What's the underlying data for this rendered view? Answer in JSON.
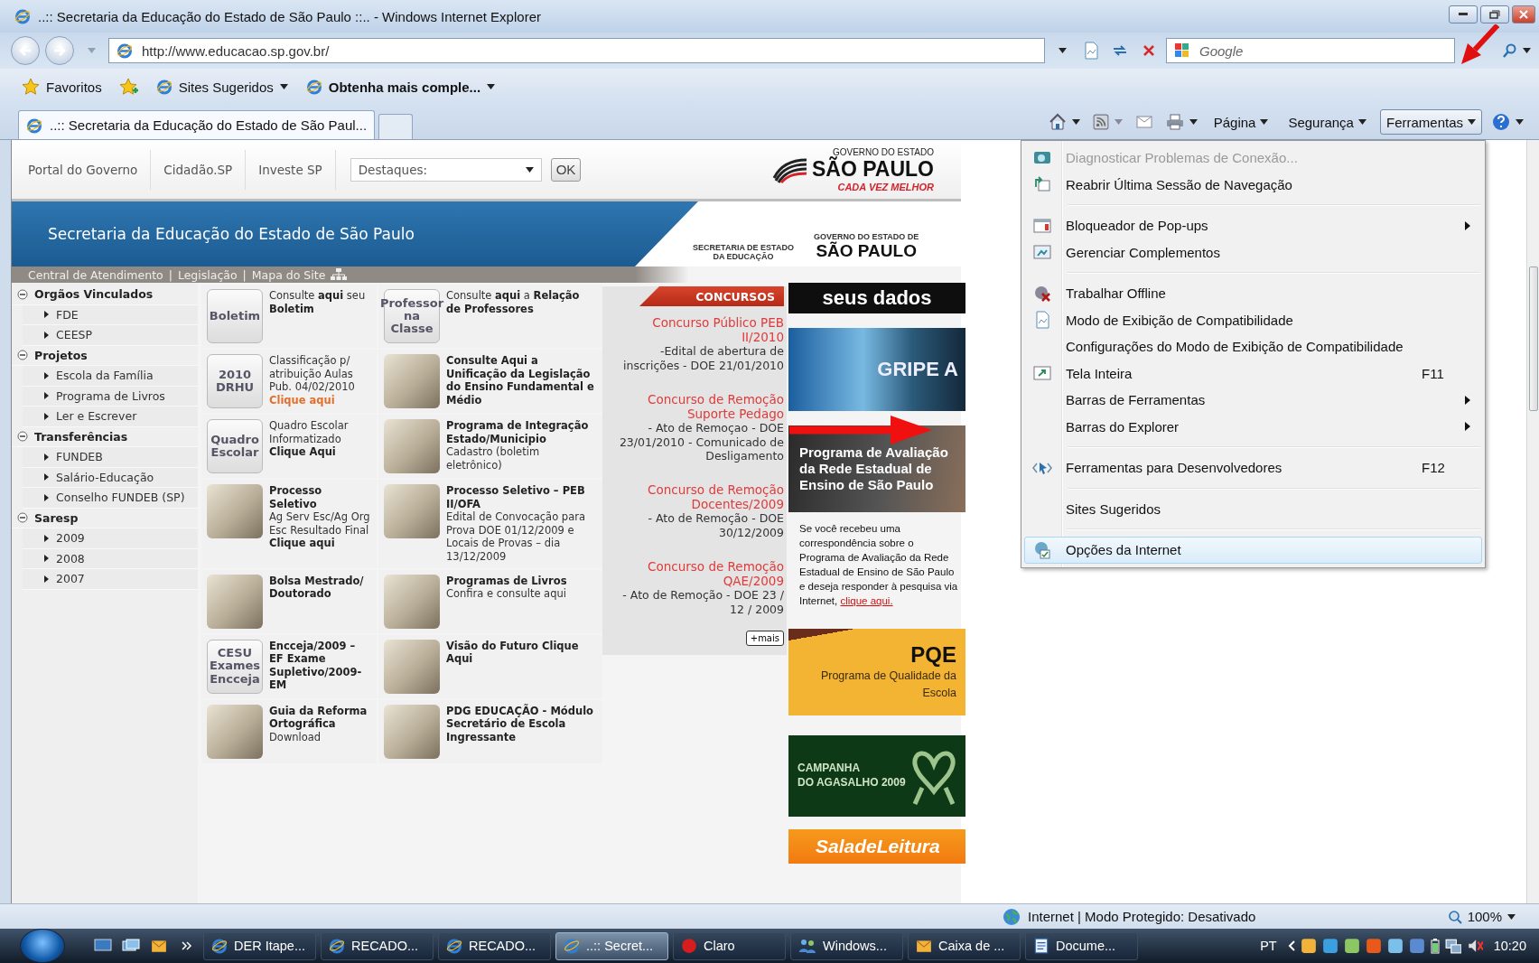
{
  "window": {
    "title": "..:: Secretaria da Educação do Estado de São Paulo ::.. - Windows Internet Explorer"
  },
  "address_bar": {
    "url": "http://www.educacao.sp.gov.br/"
  },
  "search": {
    "placeholder": "Google"
  },
  "favorites_bar": {
    "favorites": "Favoritos",
    "items": [
      {
        "label": "Sites Sugeridos",
        "bold": false
      },
      {
        "label": "Obtenha mais comple...",
        "bold": true
      }
    ]
  },
  "tabs": [
    {
      "label": "..:: Secretaria da Educação do Estado de São Paul...",
      "selected": true
    }
  ],
  "command_bar": {
    "items": [
      {
        "label": "Página",
        "selected": false
      },
      {
        "label": "Segurança",
        "selected": false
      },
      {
        "label": "Ferramentas",
        "selected": true
      }
    ]
  },
  "site": {
    "top_links": [
      "Portal do Governo",
      "Cidadão.SP",
      "Investe SP"
    ],
    "highlights_select": "Destaques:",
    "ok_button": "OK",
    "logo": {
      "top": "GOVERNO DO ESTADO",
      "name": "SÃO PAULO",
      "motto": "CADA VEZ MELHOR"
    },
    "banner": {
      "title": "Secretaria da Educação do Estado de São Paulo",
      "logos": [
        {
          "small": "SECRETARIA DE ESTADO DA EDUCAÇÃO"
        },
        {
          "small": "GOVERNO DO ESTADO DE",
          "big": "SÃO PAULO"
        }
      ]
    },
    "links": {
      "items": [
        "Central de Atendimento",
        "Legislação",
        "Mapa do Site"
      ],
      "separator": "|"
    },
    "sidebar": [
      {
        "label": "Orgãos Vinculados",
        "expanded": true,
        "children": [
          {
            "label": "FDE"
          },
          {
            "label": "CEESP"
          }
        ]
      },
      {
        "label": "Projetos",
        "expanded": true,
        "children": [
          {
            "label": "Escola da Família"
          },
          {
            "label": "Programa de Livros"
          },
          {
            "label": "Ler e Escrever"
          }
        ]
      },
      {
        "label": "Transferências",
        "expanded": true,
        "children": [
          {
            "label": "FUNDEB"
          },
          {
            "label": "Salário-Educação"
          },
          {
            "label": "Conselho FUNDEB (SP)"
          }
        ]
      },
      {
        "label": "Saresp",
        "expanded": true,
        "children": [
          {
            "label": "2009"
          },
          {
            "label": "2008"
          },
          {
            "label": "2007"
          }
        ]
      }
    ],
    "tiles": [
      {
        "image_text": [
          "Boletim"
        ],
        "text": "Consulte **aqui** seu **Boletim**"
      },
      {
        "image_text": [
          "Professor",
          "na Classe"
        ],
        "text": "Consulte **aqui** a **Relação de Professores**"
      },
      {
        "image_text": [
          "2010",
          "DRHU"
        ],
        "text": "Classificação p/ atribuição Aulas Pub. 04/02/2010",
        "link": "Clique aqui"
      },
      {
        "title": "Consulte Aqui a Unificação da Legislação do Ensino Fundamental e Médio"
      },
      {
        "image_text": [
          "Quadro",
          "Escolar"
        ],
        "text": "Quadro Escolar Informatizado **Clique Aqui**"
      },
      {
        "title": "Programa de Integração Estado/Municipio",
        "text": "Cadastro (boletim eletrônico)"
      },
      {
        "title": "Processo Seletivo",
        "text": "Ag Serv Esc/Ag Org Esc Resultado Final **Clique aqui**"
      },
      {
        "title": "Processo Seletivo – PEB II/OFA",
        "text": "Edital de Convocação para Prova DOE 01/12/2009 e Locais de Provas – dia 13/12/2009"
      },
      {
        "title": "Bolsa Mestrado/ Doutorado"
      },
      {
        "title": "Programas de Livros",
        "text": "Confira e consulte aqui"
      },
      {
        "image_text": [
          "CESU",
          "Exames",
          "Encceja"
        ],
        "title": "Encceja/2009 – EF Exame Supletivo/2009- EM"
      },
      {
        "title": "Visão do Futuro Clique Aqui"
      },
      {
        "title": "Guia da Reforma Ortográfica",
        "text": "Download"
      },
      {
        "title": "PDG EDUCAÇÃO - Módulo Secretário de Escola Ingressante"
      }
    ],
    "contests": {
      "header": "CONCURSOS",
      "more": "+mais",
      "items": [
        {
          "title": "Concurso Público PEB II/2010",
          "body": "-Edital de abertura de inscrições - DOE 21/01/2010"
        },
        {
          "title": "Concurso de Remoção Suporte Pedago",
          "body": "- Ato de Remoçao - DOE 23/01/2010 - Comunicado de Desligamento"
        },
        {
          "title": "Concurso de Remoção Docentes/2009",
          "body": "- Ato de Remoção - DOE 30/12/2009"
        },
        {
          "title": "Concurso de Remoção QAE/2009",
          "body": "- Ato de Remoção - DOE 23 / 12 / 2009"
        }
      ]
    },
    "promos": {
      "account": "seus dados",
      "flu": "GRIPE A",
      "survey": {
        "banner": "Programa de Avaliação da Rede Estadual de Ensino de São Paulo",
        "text": "Se você recebeu uma correspondência sobre o Programa de Avaliação da Rede Estadual de Ensino de São Paulo e deseja responder à pesquisa via Internet,",
        "link": "clique aqui."
      },
      "pqe": {
        "title": "PQE",
        "subtitle": "Programa de Qualidade da Escola"
      },
      "campaign": [
        "CAMPANHA",
        "DO AGASALHO 2009"
      ],
      "reading": "SaladeLeitura"
    }
  },
  "tools_menu": {
    "groups": [
      [
        {
          "label": "Diagnosticar Problemas de Conexão...",
          "kind": "connection",
          "submenu": false,
          "disabled": true,
          "selected": false
        },
        {
          "label": "Reabrir Última Sessão de Navegação",
          "kind": "reopen",
          "submenu": false,
          "disabled": false,
          "selected": false
        }
      ],
      [
        {
          "label": "Bloqueador de Pop-ups",
          "kind": "popup",
          "submenu": true,
          "disabled": false,
          "selected": false
        },
        {
          "label": "Gerenciar Complementos",
          "kind": "addons",
          "submenu": false,
          "disabled": false,
          "selected": false
        }
      ],
      [
        {
          "label": "Trabalhar Offline",
          "kind": "offline",
          "submenu": false,
          "disabled": false,
          "selected": false
        },
        {
          "label": "Modo de Exibição de Compatibilidade",
          "kind": "compat",
          "submenu": false,
          "disabled": false,
          "selected": false
        },
        {
          "label": "Configurações do Modo de Exibição de Compatibilidade",
          "kind": "plain",
          "submenu": false,
          "disabled": false,
          "selected": false
        },
        {
          "label": "Tela Inteira",
          "kind": "fullscreen",
          "shortcut": "F11",
          "submenu": false,
          "disabled": false,
          "selected": false
        },
        {
          "label": "Barras de Ferramentas",
          "kind": "plain",
          "submenu": true,
          "disabled": false,
          "selected": false
        },
        {
          "label": "Barras do Explorer",
          "kind": "plain",
          "submenu": true,
          "disabled": false,
          "selected": false
        }
      ],
      [
        {
          "label": "Ferramentas para Desenvolvedores",
          "kind": "devtools",
          "shortcut": "F12",
          "submenu": false,
          "disabled": false,
          "selected": false
        }
      ],
      [
        {
          "label": "Sites Sugeridos",
          "kind": "plain",
          "submenu": false,
          "disabled": false,
          "selected": false
        }
      ],
      [
        {
          "label": "Opções da Internet",
          "kind": "options",
          "submenu": false,
          "disabled": false,
          "selected": true
        }
      ]
    ]
  },
  "status_bar": {
    "zone": "Internet | Modo Protegido: Desativado",
    "zoom": "100%"
  },
  "taskbar": {
    "tasks": [
      {
        "label": "DER Itape...",
        "kind": "browser",
        "selected": false
      },
      {
        "label": "RECADO...",
        "kind": "browser",
        "selected": false
      },
      {
        "label": "RECADO...",
        "kind": "browser",
        "selected": false
      },
      {
        "label": "..:: Secret...",
        "kind": "browser",
        "selected": true
      },
      {
        "label": "Claro",
        "kind": "disc",
        "selected": false
      },
      {
        "label": "Windows...",
        "kind": "people",
        "selected": false
      },
      {
        "label": "Caixa de ...",
        "kind": "mail",
        "selected": false
      },
      {
        "label": "Docume...",
        "kind": "document",
        "selected": false
      }
    ],
    "language": "PT",
    "clock": "10:20"
  }
}
